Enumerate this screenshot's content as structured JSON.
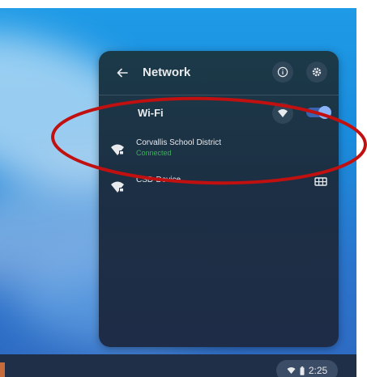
{
  "panel": {
    "title": "Network",
    "wifi_label": "Wi-Fi",
    "wifi_enabled": true
  },
  "networks": [
    {
      "name": "Corvallis School District",
      "status": "Connected"
    },
    {
      "name": "CSD-Device",
      "status": ""
    }
  ],
  "tray": {
    "time": "2:25"
  },
  "icons": {
    "back": "back-arrow-icon",
    "info": "info-icon",
    "settings": "gear-icon",
    "add_network": "add-wifi-icon",
    "network": "wifi-lock-icon",
    "extra": "grid-icon",
    "battery": "battery-icon"
  },
  "colors": {
    "panel_bg": "#1c2f44",
    "connected_status": "#3fae5c",
    "toggle_knob": "#8ab4f8",
    "annotation_ring": "#c01010"
  }
}
